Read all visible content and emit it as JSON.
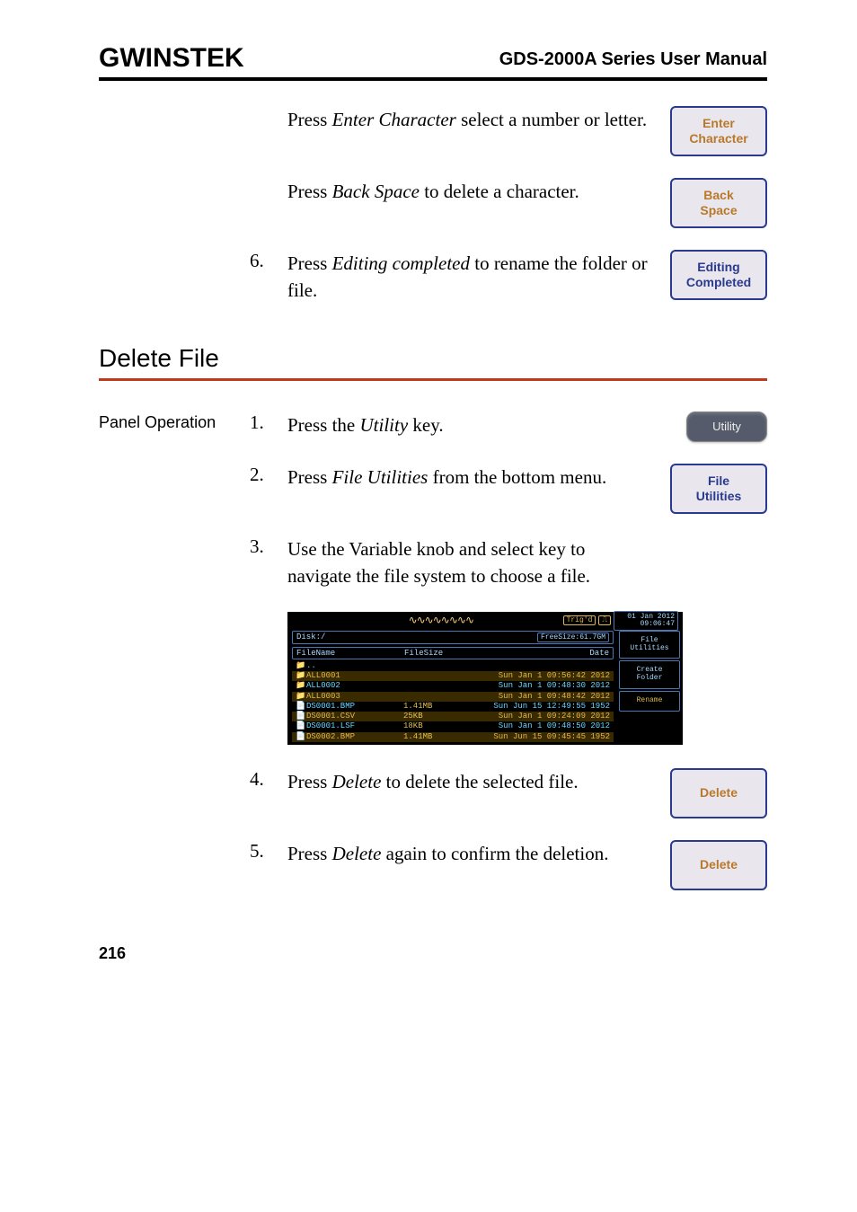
{
  "header": {
    "logo_text": "GWINSTEK",
    "title": "GDS-2000A Series User Manual"
  },
  "top_steps": [
    {
      "num": "",
      "html": "Press <em>Enter Character</em> select a number or letter.",
      "button": {
        "line1": "Enter",
        "line2": "Character",
        "style": "orange"
      }
    },
    {
      "num": "",
      "html": "Press <em>Back Space</em> to delete a character.",
      "button": {
        "line1": "Back",
        "line2": "Space",
        "style": "orange"
      }
    },
    {
      "num": "6.",
      "html": "Press <em>Editing completed</em> to rename the folder or file.",
      "button": {
        "line1": "Editing",
        "line2": "Completed",
        "style": "bluetxt"
      }
    }
  ],
  "section_heading": "Delete File",
  "delete_section": {
    "label": "Panel Operation",
    "steps": [
      {
        "num": "1.",
        "html": "Press the <em>Utility</em> key.",
        "button_type": "key",
        "button": {
          "line1": "Utility"
        }
      },
      {
        "num": "2.",
        "html": "Press <em>File Utilities</em> from the bottom menu.",
        "button_type": "scope",
        "button": {
          "line1": "File",
          "line2": "Utilities",
          "style": "bluetxt"
        }
      },
      {
        "num": "3.",
        "html": "Use the Variable knob and select key to navigate the file system to choose a file.",
        "button_type": "none"
      }
    ],
    "after_shot_steps": [
      {
        "num": "4.",
        "html": "Press <em>Delete</em> to delete the selected file.",
        "button": {
          "line1": "Delete",
          "style": "orange"
        }
      },
      {
        "num": "5.",
        "html": "Press <em>Delete</em> again to confirm the deletion.",
        "button": {
          "line1": "Delete",
          "style": "orange"
        }
      }
    ]
  },
  "fs": {
    "trig": "Trig'd",
    "date": "01 Jan 2012",
    "time": "09:06:47",
    "disk": "Disk:/",
    "freesize": "FreeSize:61.7GM",
    "side": [
      {
        "text": "File Utilities"
      },
      {
        "text": "Create\nFolder"
      },
      {
        "text": "Rename",
        "orange": true
      }
    ],
    "head": {
      "name": "FileName",
      "size": "FileSize",
      "date": "Date"
    },
    "items": [
      {
        "ic": "📁",
        "nm": "..",
        "sz": "",
        "dt": ""
      },
      {
        "ic": "📁",
        "nm": "ALL0001",
        "sz": "",
        "dt": "Sun Jan  1 09:56:42 2012",
        "hl": true
      },
      {
        "ic": "📁",
        "nm": "ALL0002",
        "sz": "",
        "dt": "Sun Jan  1 09:48:30 2012"
      },
      {
        "ic": "📁",
        "nm": "ALL0003",
        "sz": "",
        "dt": "Sun Jan  1 09:48:42 2012",
        "hl": true
      },
      {
        "ic": "📄",
        "nm": "DS0001.BMP",
        "sz": "1.41MB",
        "dt": "Sun Jun 15 12:49:55 1952"
      },
      {
        "ic": "📄",
        "nm": "DS0001.CSV",
        "sz": "25KB",
        "dt": "Sun Jan  1 09:24:09 2012",
        "hl": true
      },
      {
        "ic": "📄",
        "nm": "DS0001.LSF",
        "sz": "18KB",
        "dt": "Sun Jan  1 09:48:50 2012"
      },
      {
        "ic": "📄",
        "nm": "DS0002.BMP",
        "sz": "1.41MB",
        "dt": "Sun Jun 15 09:45:45 1952",
        "hl": true
      }
    ]
  },
  "page_number": "216"
}
